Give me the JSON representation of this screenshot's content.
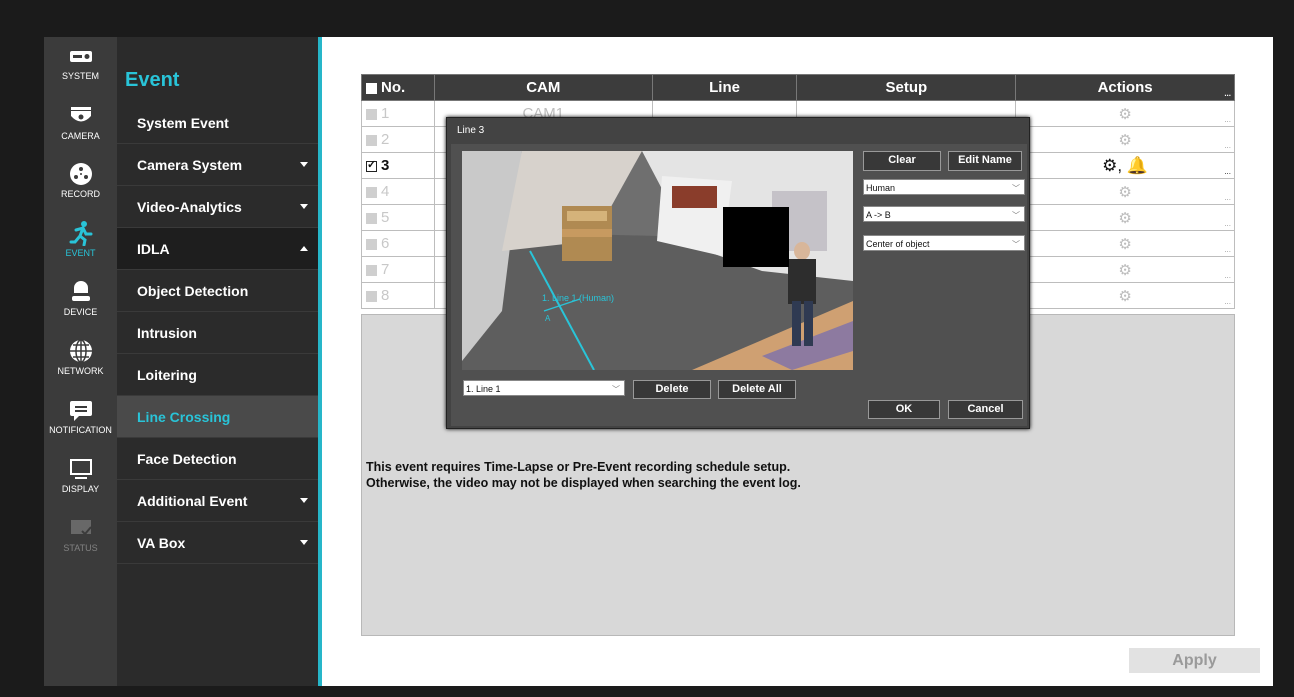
{
  "rail": [
    {
      "label": "SYSTEM",
      "icon": "system-icon"
    },
    {
      "label": "CAMERA",
      "icon": "camera-icon"
    },
    {
      "label": "RECORD",
      "icon": "record-icon"
    },
    {
      "label": "EVENT",
      "icon": "running-person-icon"
    },
    {
      "label": "DEVICE",
      "icon": "device-icon"
    },
    {
      "label": "NETWORK",
      "icon": "globe-icon"
    },
    {
      "label": "NOTIFICATION",
      "icon": "message-icon"
    },
    {
      "label": "DISPLAY",
      "icon": "monitor-icon"
    },
    {
      "label": "STATUS",
      "icon": "status-icon"
    }
  ],
  "menu": {
    "title": "Event",
    "items": [
      "System Event",
      "Camera System",
      "Video-Analytics",
      "IDLA",
      "Object Detection",
      "Intrusion",
      "Loitering",
      "Line Crossing",
      "Face Detection",
      "Additional Event",
      "VA Box"
    ]
  },
  "table": {
    "headers": [
      "No.",
      "CAM",
      "Line",
      "Setup",
      "Actions"
    ],
    "rows": [
      {
        "no": "1",
        "cam": "CAM1",
        "actions": "⚙"
      },
      {
        "no": "2",
        "cam": "",
        "actions": "⚙"
      },
      {
        "no": "3",
        "cam": "",
        "actions": "⚙, 🔔"
      },
      {
        "no": "4",
        "cam": "",
        "actions": "⚙"
      },
      {
        "no": "5",
        "cam": "",
        "actions": "⚙"
      },
      {
        "no": "6",
        "cam": "",
        "actions": "⚙"
      },
      {
        "no": "7",
        "cam": "",
        "actions": "⚙"
      },
      {
        "no": "8",
        "cam": "",
        "actions": "⚙"
      }
    ],
    "ellipsis": "..."
  },
  "notice": {
    "line1": "This event requires Time-Lapse or Pre-Event recording schedule setup.",
    "line2": "Otherwise, the video may not be displayed when searching the event log."
  },
  "apply_label": "Apply",
  "dialog": {
    "title": "Line 3",
    "clear_label": "Clear",
    "edit_name_label": "Edit Name",
    "object_type": "Human",
    "direction": "A -> B",
    "detect_point": "Center of object",
    "line_select": "1. Line 1",
    "delete_label": "Delete",
    "delete_all_label": "Delete All",
    "ok_label": "OK",
    "cancel_label": "Cancel",
    "canvas_line_label": "1. Line 1 (Human)",
    "canvas_point_a": "A"
  },
  "colors": {
    "accent": "#29c4d8",
    "header": "#3c3c3c",
    "menu_bg": "#2b2b2b",
    "rail_bg": "#3b3b3b"
  }
}
